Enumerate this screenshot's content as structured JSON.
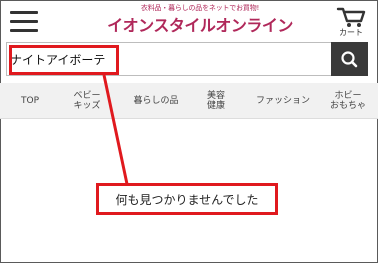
{
  "header": {
    "menu_icon": "hamburger-menu-icon",
    "tagline": "衣料品・暮らしの品をネットでお買物!",
    "logo": "イオンスタイルオンライン",
    "cart_icon": "shopping-cart-icon",
    "cart_label": "カート"
  },
  "search": {
    "value": "ナイトアイボーテ",
    "button_icon": "search-icon"
  },
  "nav": {
    "items": [
      {
        "label": "TOP"
      },
      {
        "label": "ベビー\nキッズ"
      },
      {
        "label": "暮らしの品"
      },
      {
        "label": "美容\n健康"
      },
      {
        "label": "ファッション"
      },
      {
        "label": "ホビー\nおもちゃ"
      }
    ]
  },
  "result": {
    "message": "何も見つかりませんでした"
  },
  "colors": {
    "brand": "#b0285a",
    "annotation": "#e0191e",
    "search_button": "#3a3a3a"
  }
}
